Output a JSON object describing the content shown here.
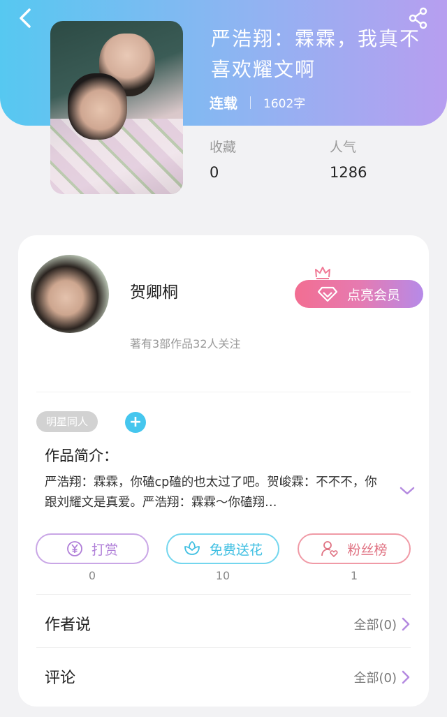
{
  "header": {
    "title": "严浩翔：霖霖，我真不喜欢耀文啊",
    "status": "连载",
    "word_count": "1602字"
  },
  "stats": {
    "favorites_label": "收藏",
    "favorites_value": "0",
    "popularity_label": "人气",
    "popularity_value": "1286"
  },
  "author": {
    "name": "贺卿桐",
    "vip_button": "点亮会员",
    "stats_text": "著有3部作品32人关注"
  },
  "tags": [
    "明星同人"
  ],
  "intro": {
    "heading": "作品简介：",
    "text": "严浩翔：霖霖，你磕cp磕的也太过了吧。贺峻霖：不不不，你跟刘耀文是真爱。严浩翔：霖霖～你磕翔…"
  },
  "actions": [
    {
      "label": "打赏",
      "count": "0",
      "icon": "yen-coin-icon",
      "color": "#b07fd8"
    },
    {
      "label": "免费送花",
      "count": "10",
      "icon": "flower-icon",
      "color": "#3fbfe2"
    },
    {
      "label": "粉丝榜",
      "count": "1",
      "icon": "user-heart-icon",
      "color": "#e07383"
    }
  ],
  "rows": [
    {
      "title": "作者说",
      "all": "全部(0)"
    },
    {
      "title": "评论",
      "all": "全部(0)"
    }
  ],
  "colors": {
    "header_gradient_start": "#56c8f1",
    "header_gradient_end": "#b79ef0",
    "vip_gradient_start": "#f26e92",
    "vip_gradient_end": "#b68ae8",
    "chevron": "#b48ae0"
  }
}
